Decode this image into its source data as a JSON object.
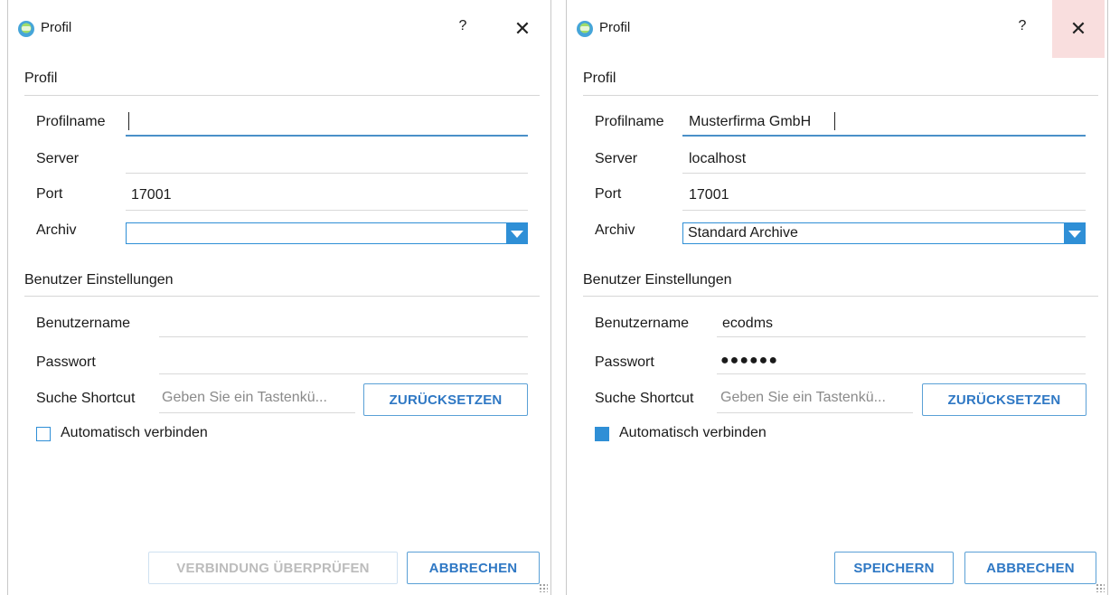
{
  "dialogs": [
    {
      "title": "Profil",
      "help": "?",
      "close": "✕",
      "section_profile": "Profil",
      "profilname_label": "Profilname",
      "profilname_value": "",
      "server_label": "Server",
      "server_value": "",
      "port_label": "Port",
      "port_value": "17001",
      "archiv_label": "Archiv",
      "archiv_value": "",
      "section_user": "Benutzer Einstellungen",
      "username_label": "Benutzername",
      "username_value": "",
      "password_label": "Passwort",
      "password_value": "",
      "shortcut_label": "Suche Shortcut",
      "shortcut_placeholder": "Geben Sie ein Tastenkü...",
      "reset_button": "ZURÜCKSETZEN",
      "auto_connect_label": "Automatisch verbinden",
      "auto_connect_checked": false,
      "primary_button": "VERBINDUNG ÜBERPRÜFEN",
      "primary_enabled": false,
      "cancel_button": "ABBRECHEN"
    },
    {
      "title": "Profil",
      "help": "?",
      "close": "✕",
      "section_profile": "Profil",
      "profilname_label": "Profilname",
      "profilname_value": "Musterfirma GmbH",
      "server_label": "Server",
      "server_value": "localhost",
      "port_label": "Port",
      "port_value": "17001",
      "archiv_label": "Archiv",
      "archiv_value": "Standard Archive",
      "section_user": "Benutzer Einstellungen",
      "username_label": "Benutzername",
      "username_value": "ecodms",
      "password_label": "Passwort",
      "password_value": "●●●●●●",
      "shortcut_label": "Suche Shortcut",
      "shortcut_placeholder": "Geben Sie ein Tastenkü...",
      "reset_button": "ZURÜCKSETZEN",
      "auto_connect_label": "Automatisch verbinden",
      "auto_connect_checked": true,
      "primary_button": "SPEICHERN",
      "primary_enabled": true,
      "cancel_button": "ABBRECHEN"
    }
  ],
  "colors": {
    "accent": "#2f8fd6",
    "focus_underline": "#4a90c8",
    "button_text": "#2f78c4",
    "close_hover": "#f9dede"
  },
  "icons": {
    "app": "ecodms-logo-icon",
    "help": "help-icon",
    "close": "close-icon",
    "combo": "chevron-down-icon"
  }
}
